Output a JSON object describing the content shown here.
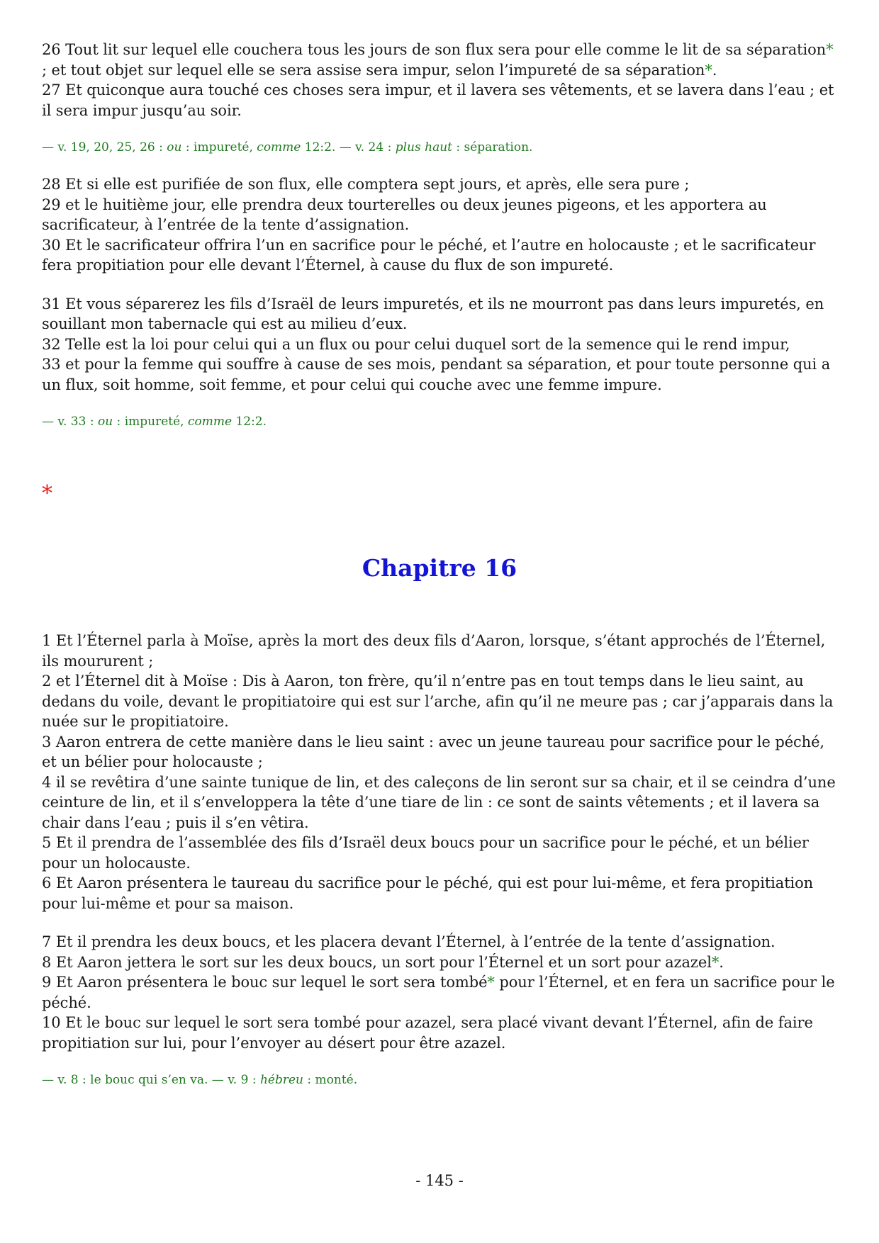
{
  "top": {
    "v26a": "26 Tout lit sur lequel elle couchera tous les jours de son flux sera pour elle comme le lit de sa séparation",
    "v26b": " ; et tout objet sur lequel elle se sera assise sera impur, selon l’impureté de sa séparation",
    "v26c": ".",
    "v27": "27 Et quiconque aura touché ces choses sera impur, et il lavera ses vêtements, et se lavera dans l’eau ; et il sera impur jusqu’au soir.",
    "note1": {
      "a": "— v. 19, 20, 25, 26 : ",
      "b": "ou",
      "c": " : impureté, ",
      "d": "comme",
      "e": " 12:2. — v. 24 : ",
      "f": "plus haut",
      "g": " : séparation."
    },
    "v28": "28 Et si elle est purifiée de son flux, elle comptera sept jours, et après, elle sera pure ;",
    "v29": "29 et le huitième jour, elle prendra deux tourterelles ou deux jeunes pigeons, et les apportera au sacrificateur, à l’entrée de la tente d’assignation.",
    "v30": "30 Et le sacrificateur offrira l’un en sacrifice pour le péché, et l’autre en holocauste ; et le sacrificateur fera propitiation pour elle devant l’Éternel, à cause du flux de son impureté.",
    "v31": "31 Et vous séparerez les fils d’Israël de leurs impuretés, et ils ne mourront pas dans leurs impuretés, en souillant mon tabernacle qui est au milieu d’eux.",
    "v32": "32 Telle est la loi pour celui qui a un flux ou pour celui duquel sort de la semence qui le rend impur,",
    "v33": "33 et pour la femme qui souffre à cause de ses mois, pendant sa séparation, et pour toute personne qui a un flux, soit homme, soit femme, et pour celui qui couche avec une femme impure.",
    "note2": {
      "a": "— v. 33 : ",
      "b": "ou",
      "c": " : impureté, ",
      "d": "comme",
      "e": " 12:2."
    }
  },
  "separator": "*",
  "star_marker": "*",
  "chapter_title": "Chapitre 16",
  "ch16": {
    "v1": "1 Et l’Éternel parla à Moïse, après la mort des deux fils d’Aaron, lorsque, s’étant approchés de l’Éternel, ils moururent ;",
    "v2": "2 et l’Éternel dit à Moïse : Dis à Aaron, ton frère, qu’il n’entre pas en tout temps dans le lieu saint, au dedans du voile, devant le propitiatoire qui est sur l’arche, afin qu’il ne meure pas ; car j’apparais dans la nuée sur le propitiatoire.",
    "v3": "3 Aaron entrera de cette manière dans le lieu saint : avec un jeune taureau pour sacrifice pour le péché, et un bélier pour holocauste ;",
    "v4": "4 il se revêtira d’une sainte tunique de lin, et des caleçons de lin seront sur sa chair, et il se ceindra d’une ceinture de lin, et il s’enveloppera la tête d’une tiare de lin : ce sont de saints vêtements ; et il lavera sa chair dans l’eau ; puis il s’en vêtira.",
    "v5": "5 Et il prendra de l’assemblée des fils d’Israël deux boucs pour un sacrifice pour le péché, et un bélier pour un holocauste.",
    "v6": "6 Et Aaron présentera le taureau du sacrifice pour le péché, qui est pour lui-même, et fera propitiation pour lui-même et pour sa maison.",
    "v7": "7 Et il prendra les deux boucs, et les placera devant l’Éternel, à l’entrée de la tente d’assignation.",
    "v8a": "8 Et Aaron jettera le sort sur les deux boucs, un sort pour l’Éternel et un sort pour azazel",
    "v8b": ".",
    "v9a": "9 Et Aaron présentera le bouc sur lequel le sort sera tombé",
    "v9b": " pour l’Éternel, et en fera un sacrifice pour le péché.",
    "v10": "10 Et le bouc sur lequel le sort sera tombé pour azazel, sera placé vivant devant l’Éternel, afin de faire propitiation sur lui, pour l’envoyer au désert pour être azazel.",
    "note3": {
      "a": "— v. 8 : le bouc qui s’en va. — v. 9 : ",
      "b": "hébreu",
      "c": " : monté."
    }
  },
  "page_number": "- 145 -"
}
